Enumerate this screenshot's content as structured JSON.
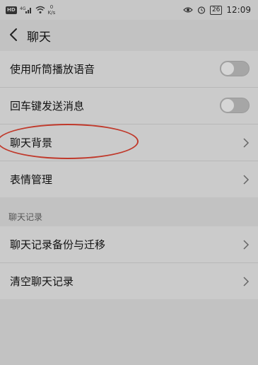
{
  "status_bar": {
    "hd": "HD",
    "signal": "4G",
    "net_speed_value": "0",
    "net_speed_unit": "K/s",
    "battery": "26",
    "time": "12:09"
  },
  "header": {
    "title": "聊天"
  },
  "settings": {
    "rows": [
      {
        "label": "使用听筒播放语音",
        "control": "toggle",
        "on": false
      },
      {
        "label": "回车键发送消息",
        "control": "toggle",
        "on": false
      },
      {
        "label": "聊天背景",
        "control": "chevron"
      },
      {
        "label": "表情管理",
        "control": "chevron"
      }
    ]
  },
  "chat_records": {
    "section_title": "聊天记录",
    "rows": [
      {
        "label": "聊天记录备份与迁移",
        "control": "chevron"
      },
      {
        "label": "清空聊天记录",
        "control": "chevron"
      }
    ]
  },
  "colors": {
    "annotation_oval": "#c0392b",
    "background": "#c2c2c2"
  },
  "icons": [
    "back-arrow-icon",
    "eye-icon",
    "alarm-icon",
    "wifi-icon",
    "chevron-right-icon"
  ]
}
